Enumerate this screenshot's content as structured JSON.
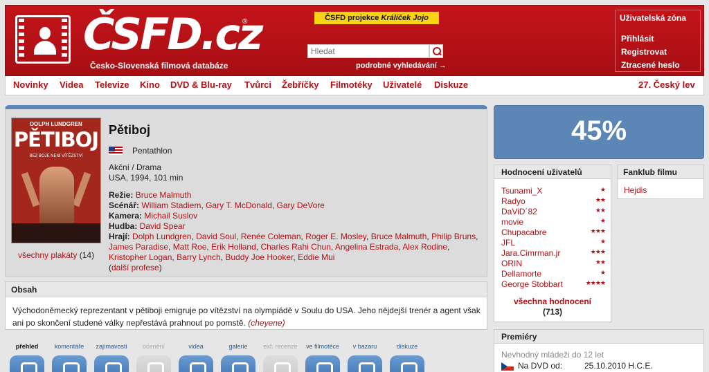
{
  "header": {
    "logo_text": "ČSFD.cz",
    "logo_reg": "®",
    "tagline": "Česko-Slovenská filmová databáze",
    "project_prefix": "ČSFD projekce ",
    "project_name": "Králíček Jojo",
    "search_placeholder": "Hledat",
    "advanced_search": "podrobné vyhledávání →",
    "user_zone": {
      "title": "Uživatelská zóna",
      "links": [
        "Přihlásit",
        "Registrovat",
        "Ztracené heslo"
      ]
    }
  },
  "nav": {
    "items": [
      "Novinky",
      "Videa",
      "Televize",
      "Kino",
      "DVD & Blu-ray",
      "Tvůrci",
      "Žebříčky",
      "Filmotéky",
      "Uživatelé",
      "Diskuze"
    ],
    "right": "27. Český lev"
  },
  "poster": {
    "actor": "DOLPH LUNDGREN",
    "title": "PĚTIBOJ",
    "subtitle": "BEZ BOJE NENÍ VÍTĚZSTVÍ",
    "link_label": "všechny plakáty",
    "count": "(14)"
  },
  "film": {
    "title": "Pětiboj",
    "original_title": "Pentathlon",
    "genre": "Akční / Drama",
    "origin": "USA, 1994, 101 min",
    "director_label": "Režie:",
    "director": "Bruce Malmuth",
    "writers_label": "Scénář:",
    "writers": [
      "William Stadiem",
      "Gary T. McDonald",
      "Gary DeVore"
    ],
    "camera_label": "Kamera:",
    "camera": "Michail Suslov",
    "music_label": "Hudba:",
    "music": "David Spear",
    "actors_label": "Hrají:",
    "actors": [
      "Dolph Lundgren",
      "David Soul",
      "Renée Coleman",
      "Roger E. Mosley",
      "Bruce Malmuth",
      "Philip Bruns",
      "James Paradise",
      "Matt Roe",
      "Erik Holland",
      "Charles Rahi Chun",
      "Angelina Estrada",
      "Alex Rodine",
      "Kristopher Logan",
      "Barry Lynch",
      "Buddy Joe Hooker",
      "Eddie Mui"
    ],
    "more_professions": "další profese"
  },
  "plot": {
    "heading": "Obsah",
    "text": "Východoněmecký reprezentant v pětiboji emigruje po vítězství na olympiádě v Soulu do USA. Jeho nějdejší trenér a agent však ani po skončení studené války nepřestává prahnout po pomstě.",
    "author": "(cheyene)"
  },
  "tabs": [
    {
      "label": "přehled",
      "state": "active"
    },
    {
      "label": "komentáře",
      "state": "normal"
    },
    {
      "label": "zajímavosti",
      "state": "normal"
    },
    {
      "label": "ocenění",
      "state": "disabled"
    },
    {
      "label": "videa",
      "state": "normal"
    },
    {
      "label": "galerie",
      "state": "normal"
    },
    {
      "label": "ext. recenze",
      "state": "disabled"
    },
    {
      "label": "ve filmotéce",
      "state": "normal"
    },
    {
      "label": "v bazaru",
      "state": "normal"
    },
    {
      "label": "diskuze",
      "state": "normal"
    }
  ],
  "rating": {
    "value": "45%"
  },
  "user_ratings": {
    "heading": "Hodnocení uživatelů",
    "items": [
      {
        "user": "Tsunami_X",
        "stars": 1
      },
      {
        "user": "Radyo",
        "stars": 2
      },
      {
        "user": "DaViD´82",
        "stars": 2
      },
      {
        "user": "movie",
        "stars": 1
      },
      {
        "user": "Chupacabre",
        "stars": 3
      },
      {
        "user": "JFL",
        "stars": 1
      },
      {
        "user": "Jara.Cimrman.jr",
        "stars": 3
      },
      {
        "user": "ORIN",
        "stars": 2
      },
      {
        "user": "Dellamorte",
        "stars": 1
      },
      {
        "user": "George Stobbart",
        "stars": 4
      }
    ],
    "all_link": "všechna hodnocení",
    "all_count": "(713)"
  },
  "fanclub": {
    "heading": "Fanklub filmu",
    "members": [
      "Hejdis"
    ]
  },
  "premiere": {
    "heading": "Premiéry",
    "age_note": "Nevhodný mládeži do 12 let",
    "dvd_label": "Na DVD od:",
    "dvd_date": "25.10.2010 H.C.E."
  },
  "colors": {
    "brand_red": "#b40f14",
    "rating_blue": "#5b86b5",
    "banner_yellow": "#f8d215"
  }
}
